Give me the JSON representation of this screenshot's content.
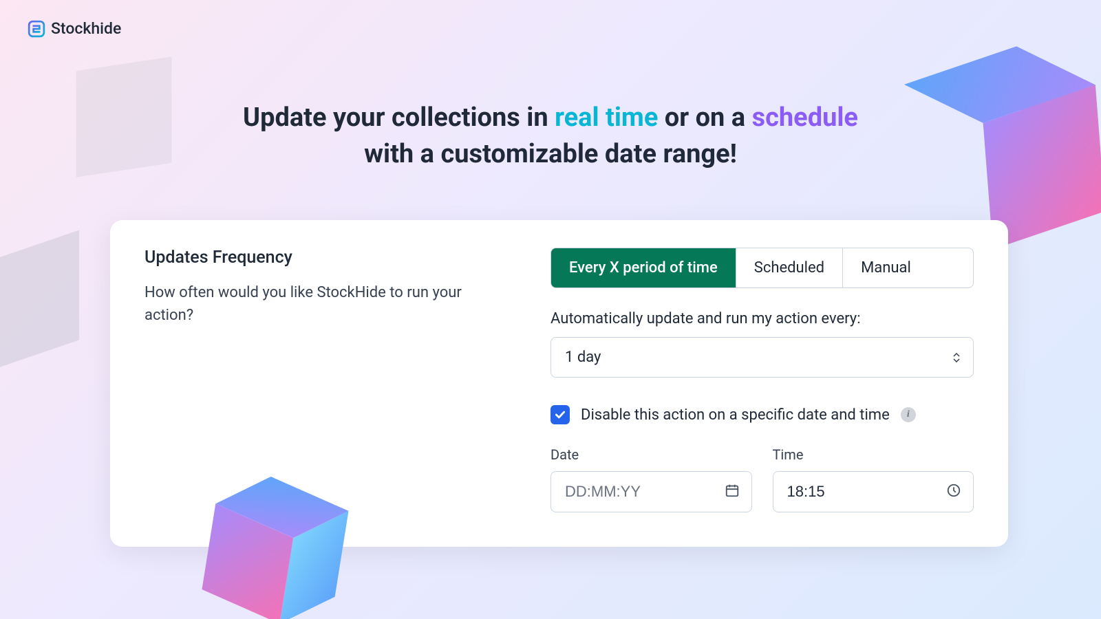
{
  "brand": {
    "name": "Stockhide"
  },
  "headline": {
    "part1": "Update your collections in ",
    "highlight1": "real time",
    "part2": " or on a ",
    "highlight2": "schedule",
    "part3": "with a customizable date range!"
  },
  "card": {
    "title": "Updates Frequency",
    "description": "How often would you like StockHide to run your action?",
    "tabs": [
      {
        "label": "Every X period of time",
        "active": true
      },
      {
        "label": "Scheduled",
        "active": false
      },
      {
        "label": "Manual",
        "active": false
      }
    ],
    "auto_label": "Automatically update and run my action every:",
    "period_value": "1 day",
    "disable_checkbox": {
      "checked": true,
      "label": "Disable this action on a specific date and time"
    },
    "date_field": {
      "label": "Date",
      "placeholder": "DD:MM:YY",
      "value": ""
    },
    "time_field": {
      "label": "Time",
      "value": "18:15"
    }
  }
}
